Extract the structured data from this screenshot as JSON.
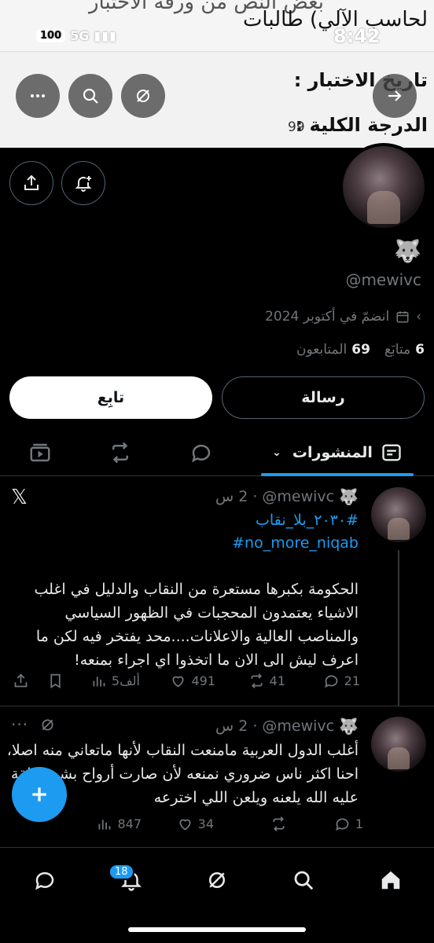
{
  "status": {
    "time": "8:42",
    "battery": "100",
    "network": "5G"
  },
  "banner": {
    "faded_text": "بعض النص من ورقة الاختبار",
    "title": "لحاسب الآلي) طالبات",
    "line1": "تاريخ الاختبار :",
    "line2": "الدرجة الكلية :",
    "score": "99"
  },
  "profile": {
    "emoji": "🐺",
    "handle": "@mewivc",
    "joined": "انضمّ في أكتوبر 2024",
    "following_count": "6",
    "following_label": "متابَع",
    "followers_count": "69",
    "followers_label": "المتابعون",
    "follow_label": "تابِع",
    "message_label": "رسالة"
  },
  "tabs": {
    "posts_label": "المنشورات"
  },
  "posts": [
    {
      "emoji": "🐺",
      "handle": "@mewivc",
      "time": "2 س",
      "hashtag1": "#٢٠٣٠_بلا_نقاب",
      "hashtag2": "#no_more_niqab",
      "text": "الحكومة بكبرها مستعرة من النقاب والدليل في اغلب الاشياء يعتمدون المحجبات في الظهور السياسي والمناصب العالية والاعلانات....محد يفتخر فيه لكن ما اعرف ليش الى الان ما اتخذوا اي اجراء بمنعه!",
      "replies": "21",
      "reposts": "41",
      "likes": "491",
      "views": "5ألف"
    },
    {
      "emoji": "🐺",
      "handle": "@mewivc",
      "time": "2 س",
      "text": "أغلب الدول العربية مامنعت النقاب لأنها ماتعاني منه اصلا، احنا اكثر ناس ضروري نمنعه لأن صارت أرواح بشر معلقة عليه الله يلعنه ويلعن اللي اخترعه",
      "replies": "1",
      "likes": "34",
      "views": "847"
    }
  ],
  "nav": {
    "notifications_badge": "18"
  },
  "colors": {
    "accent": "#1d9bf0",
    "background": "#000000",
    "muted": "#71767b"
  }
}
